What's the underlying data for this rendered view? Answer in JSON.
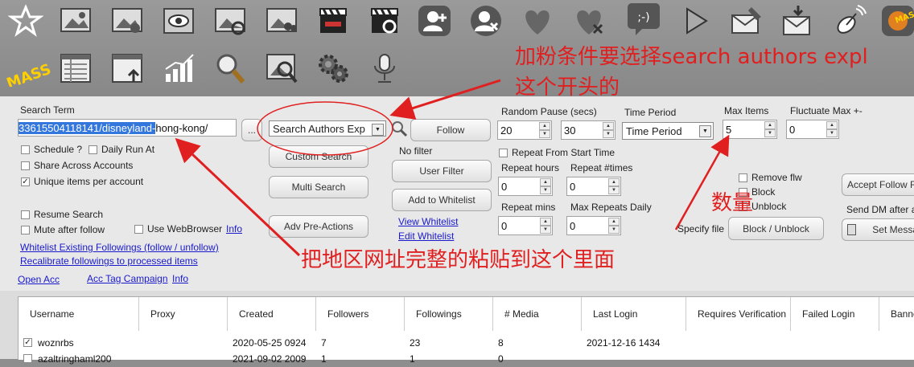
{
  "toolbar": {
    "mass_label": "MASS",
    "mass_small": "MASS",
    "chat_glyph": ";-)"
  },
  "search": {
    "term_label": "Search Term",
    "term_selected": "33615504118141/disneyland-",
    "term_rest": "hong-kong/",
    "browse_label": "...",
    "mode_value": "Search Authors Exp",
    "follow_label": "Follow",
    "no_filter": "No filter",
    "custom_search": "Custom Search",
    "user_filter": "User Filter",
    "multi_search": "Multi Search",
    "add_whitelist": "Add to Whitelist",
    "view_whitelist": "View Whitelist",
    "edit_whitelist": "Edit Whitelist",
    "adv_pre_actions": "Adv Pre-Actions"
  },
  "options": {
    "schedule": "Schedule ?",
    "daily_run": "Daily Run At",
    "share_accounts": "Share Across Accounts",
    "unique_items": "Unique items per account",
    "resume_search": "Resume Search",
    "mute_after_follow": "Mute after follow",
    "use_webbrowser": "Use WebBrowser",
    "info": "Info",
    "whitelist_existing": "Whitelist Existing Followings (follow / unfollow)",
    "recalibrate": "Recalibrate followings to processed items",
    "open_acc": "Open Acc",
    "acc_tag_campaign": "Acc Tag Campaign",
    "info2": "Info"
  },
  "timing": {
    "random_pause_label": "Random Pause (secs)",
    "pause_min": "20",
    "pause_max": "30",
    "time_period_label": "Time Period",
    "time_period_value": "Time Period",
    "max_items_label": "Max Items",
    "max_items": "5",
    "fluctuate_label": "Fluctuate Max +-",
    "fluctuate": "0",
    "repeat_from_start": "Repeat From Start Time",
    "repeat_hours_label": "Repeat hours",
    "repeat_hours": "0",
    "repeat_times_label": "Repeat #times",
    "repeat_times": "0",
    "repeat_mins_label": "Repeat mins",
    "repeat_mins": "0",
    "max_repeats_label": "Max Repeats Daily",
    "max_repeats": "0"
  },
  "right": {
    "remove_flw": "Remove flw",
    "block": "Block",
    "unblock": "Unblock",
    "specify_file": "Specify file",
    "block_unblock": "Block / Unblock",
    "accept_follow": "Accept Follow Re",
    "send_dm": "Send DM after a",
    "set_message": "Set Messa"
  },
  "annotations": {
    "top_line1": "加粉条件要选择search authors expl",
    "top_line2": "这个开头的",
    "quantity": "数量",
    "paste_hint": "把地区网址完整的粘贴到这个里面"
  },
  "table": {
    "columns": [
      "Username",
      "Proxy",
      "Created",
      "Followers",
      "Followings",
      "# Media",
      "Last Login",
      "Requires Verification",
      "Failed Login",
      "Banne"
    ],
    "rows": [
      {
        "checked": true,
        "cells": [
          "woznrbs",
          "",
          "2020-05-25 0924",
          "7",
          "23",
          "8",
          "2021-12-16 1434",
          "",
          "",
          ""
        ]
      },
      {
        "checked": false,
        "cells": [
          "azaltringhaml200",
          "",
          "2021-09-02 2009",
          "1",
          "1",
          "0",
          "",
          "",
          "",
          ""
        ]
      }
    ]
  },
  "colors": {
    "annotation_red": "#e02020",
    "link_blue": "#1a1acc",
    "selection_blue": "#3377dd"
  }
}
